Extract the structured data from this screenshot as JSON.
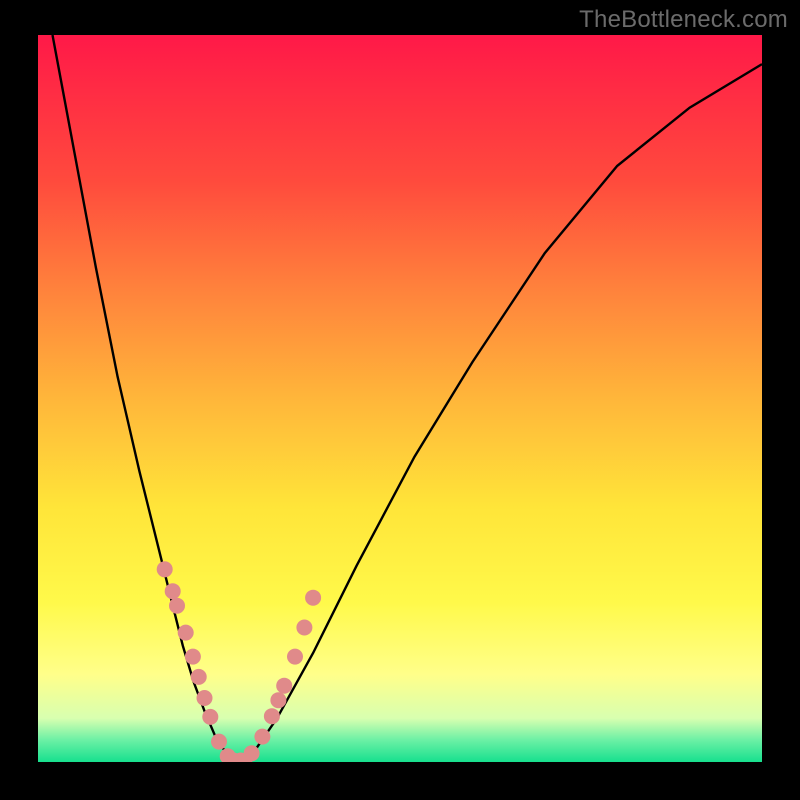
{
  "watermark": "TheBottleneck.com",
  "chart_data": {
    "type": "line",
    "title": "",
    "xlabel": "",
    "ylabel": "",
    "xlim": [
      0,
      100
    ],
    "ylim": [
      0,
      100
    ],
    "series": [
      {
        "name": "bottleneck-curve",
        "x": [
          2,
          5,
          8,
          11,
          14,
          17,
          18.5,
          20,
          21.5,
          23,
          24.5,
          26,
          27.5,
          29,
          33,
          38,
          44,
          52,
          60,
          70,
          80,
          90,
          100
        ],
        "y": [
          100,
          84,
          68,
          53,
          40,
          28,
          22,
          16,
          11,
          7,
          3.5,
          1.2,
          0.2,
          0.2,
          6,
          15,
          27,
          42,
          55,
          70,
          82,
          90,
          96
        ]
      }
    ],
    "markers": {
      "name": "highlight-dots",
      "color": "#e08a8a",
      "points_x": [
        17.5,
        18.6,
        19.2,
        20.4,
        21.4,
        22.2,
        23.0,
        23.8,
        25.0,
        26.2,
        27.0,
        28.0,
        29.5,
        31.0,
        32.3,
        33.2,
        34.0,
        35.5,
        36.8,
        38.0
      ],
      "points_y": [
        26.5,
        23.5,
        21.5,
        17.8,
        14.5,
        11.7,
        8.8,
        6.2,
        2.8,
        0.8,
        0.2,
        0.2,
        1.2,
        3.5,
        6.3,
        8.5,
        10.5,
        14.5,
        18.5,
        22.6
      ]
    },
    "flat_bottom_segment": {
      "y": 0.2,
      "x_from": 26.0,
      "x_to": 29.0
    },
    "gradient_stops": [
      {
        "pct": 0,
        "color": "#ff1948"
      },
      {
        "pct": 20,
        "color": "#ff4a3d"
      },
      {
        "pct": 35,
        "color": "#ff823c"
      },
      {
        "pct": 50,
        "color": "#ffb63a"
      },
      {
        "pct": 65,
        "color": "#ffe539"
      },
      {
        "pct": 78,
        "color": "#fff94a"
      },
      {
        "pct": 88,
        "color": "#ffff8a"
      },
      {
        "pct": 94,
        "color": "#d8ffb0"
      },
      {
        "pct": 97,
        "color": "#6bf0a5"
      },
      {
        "pct": 100,
        "color": "#17e08e"
      }
    ]
  }
}
